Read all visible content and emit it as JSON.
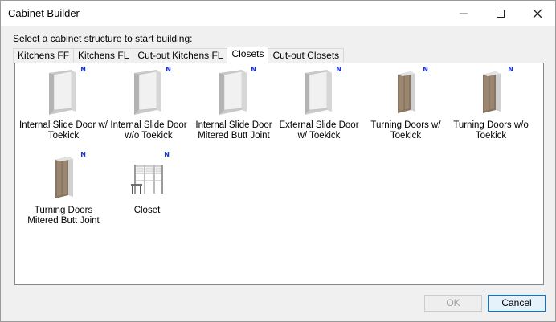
{
  "window": {
    "title": "Cabinet Builder"
  },
  "prompt": "Select a cabinet structure to start building:",
  "tabs": [
    {
      "label": "Kitchens FF"
    },
    {
      "label": "Kitchens FL"
    },
    {
      "label": "Cut-out Kitchens FL"
    },
    {
      "label": "Closets"
    },
    {
      "label": "Cut-out Closets"
    }
  ],
  "active_tab": "Closets",
  "badge": "N",
  "items": [
    {
      "label": "Internal Slide Door w/ Toekick",
      "icon": "slide-door-cabinet-icon"
    },
    {
      "label": "Internal Slide Door w/o Toekick",
      "icon": "slide-door-cabinet-icon"
    },
    {
      "label": "Internal Slide Door Mitered Butt Joint",
      "icon": "slide-door-cabinet-icon"
    },
    {
      "label": "External Slide Door w/ Toekick",
      "icon": "slide-door-cabinet-icon"
    },
    {
      "label": "Turning Doors w/ Toekick",
      "icon": "turning-door-cabinet-icon"
    },
    {
      "label": "Turning Doors  w/o Toekick",
      "icon": "turning-door-cabinet-icon"
    },
    {
      "label": "Turning Doors Mitered Butt Joint",
      "icon": "turning-door-cabinet-icon"
    },
    {
      "label": "Closet",
      "icon": "closet-shelving-icon"
    }
  ],
  "buttons": {
    "ok": "OK",
    "cancel": "Cancel"
  },
  "colors": {
    "badge": "#1a35d6",
    "wood": "#8a7560",
    "focus_border": "#0078d7"
  }
}
